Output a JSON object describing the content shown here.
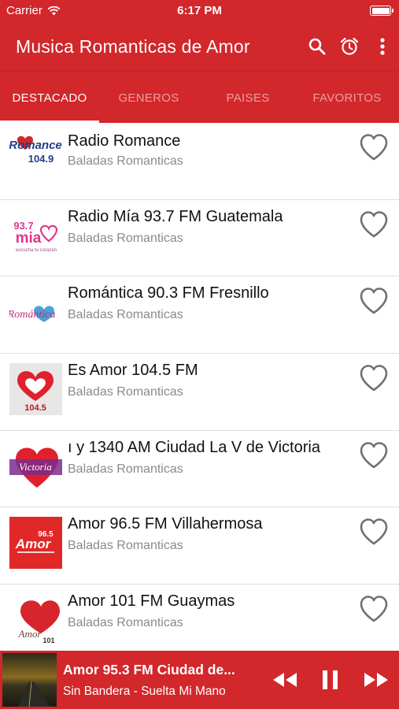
{
  "status_bar": {
    "carrier": "Carrier",
    "time": "6:17 PM"
  },
  "app_bar": {
    "title": "Musica Romanticas de Amor",
    "icons": [
      "search-icon",
      "alarm-clock-icon",
      "more-vert-icon"
    ]
  },
  "tabs": [
    {
      "label": "DESTACADO",
      "active": true
    },
    {
      "label": "GENEROS",
      "active": false
    },
    {
      "label": "PAISES",
      "active": false
    },
    {
      "label": "FAVORITOS",
      "active": false
    }
  ],
  "stations": [
    {
      "name": "Radio Romance",
      "genre": "Baladas Romanticas",
      "logo_text": [
        "Romance",
        "104.9"
      ]
    },
    {
      "name": "Radio Mía 93.7 FM Guatemala",
      "genre": "Baladas Romanticas",
      "logo_text": [
        "93.7",
        "mia",
        "escucha tu corazón"
      ]
    },
    {
      "name": "Romántica 90.3 FM Fresnillo",
      "genre": "Baladas Romanticas",
      "logo_text": [
        "Romántica"
      ]
    },
    {
      "name": "Es Amor 104.5 FM",
      "genre": "Baladas Romanticas",
      "logo_text": [
        "104.5"
      ]
    },
    {
      "name": "ı y 1340 AM Ciudad La V de Victoria",
      "genre": "Baladas Romanticas",
      "logo_text": [
        "Victoria"
      ]
    },
    {
      "name": "Amor 96.5 FM Villahermosa",
      "genre": "Baladas Romanticas",
      "logo_text": [
        "96.5",
        "Amor"
      ]
    },
    {
      "name": "Amor 101 FM Guaymas",
      "genre": "Baladas Romanticas",
      "logo_text": [
        "Amor",
        "101"
      ]
    }
  ],
  "player": {
    "track": "Amor 95.3 FM Ciudad de...",
    "artist": "Sin Bandera - Suelta Mi Mano",
    "controls": [
      "rewind-icon",
      "pause-icon",
      "fast-forward-icon"
    ]
  },
  "colors": {
    "primary": "#d2272b",
    "text": "#111111",
    "subtext": "#8a8a8a",
    "divider": "#dedede"
  }
}
